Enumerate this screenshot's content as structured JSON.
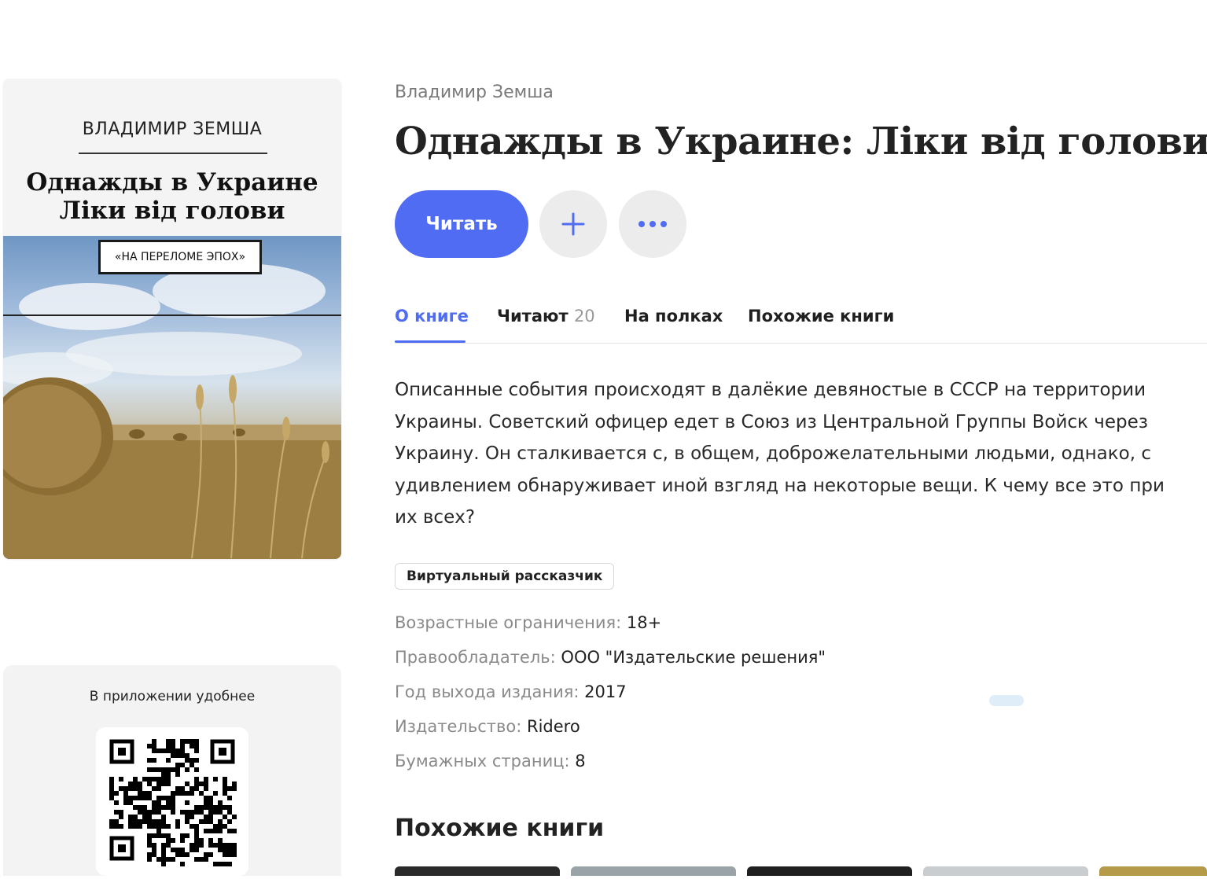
{
  "book": {
    "author": "Владимир Земша",
    "title": "Однажды в Украине: Ліки від голови"
  },
  "cover": {
    "author": "ВЛАДИМИР ЗЕМША",
    "title_line1": "Однажды в Украине",
    "title_line2": "Ліки від голови",
    "series": "«НА ПЕРЕЛОМЕ ЭПОХ»"
  },
  "actions": {
    "read_label": "Читать"
  },
  "tabs": [
    {
      "label": "О книге",
      "active": true
    },
    {
      "label": "Читают",
      "count": "20"
    },
    {
      "label": "На полках"
    },
    {
      "label": "Похожие книги"
    }
  ],
  "description": [
    "Описанные события происходят в далёкие девяностые в СССР на территории",
    "Украины. Советский офицер едет в Союз из Центральной Группы Войск через",
    "Украину. Он сталкивается с, в общем, доброжелательными людьми, однако, с",
    "удивлением обнаруживает иной взгляд на некоторые вещи. К чему все это при",
    "их всех?"
  ],
  "badge": "Виртуальный рассказчик",
  "meta": [
    {
      "label": "Возрастные ограничения:",
      "value": "18+"
    },
    {
      "label": "Правообладатель:",
      "value": "ООО \"Издательские решения\""
    },
    {
      "label": "Год выхода издания:",
      "value": "2017"
    },
    {
      "label": "Издательство:",
      "value": "Ridero"
    },
    {
      "label": "Бумажных страниц:",
      "value": "8"
    }
  ],
  "promo": {
    "text": "В приложении удобнее"
  },
  "similar": {
    "heading": "Похожие книги"
  },
  "colors": {
    "accent": "#4f6cf3",
    "button_gray": "#ececec",
    "muted_text": "#8a8a8a"
  }
}
